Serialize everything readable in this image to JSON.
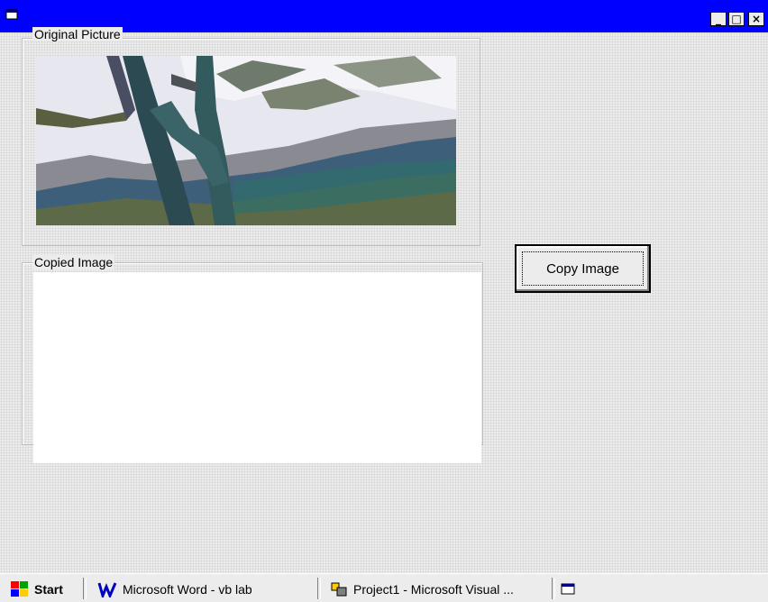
{
  "window": {
    "title": "",
    "controls": {
      "minimize": "_",
      "maximize": "□",
      "close": "×"
    }
  },
  "original_frame": {
    "label": "Original Picture"
  },
  "copied_frame": {
    "label": "Copied Image"
  },
  "copy_button": {
    "label": "Copy Image"
  },
  "taskbar": {
    "start_label": "Start",
    "items": [
      {
        "label": "Microsoft Word - vb lab",
        "icon": "word-icon"
      },
      {
        "label": "Project1 - Microsoft Visual ...",
        "icon": "vb-project-icon"
      },
      {
        "label": "",
        "icon": "form-window-icon"
      }
    ]
  },
  "colors": {
    "titlebar": "#0000ff",
    "desktop": "#ececec",
    "image_box": "#ffffff"
  }
}
